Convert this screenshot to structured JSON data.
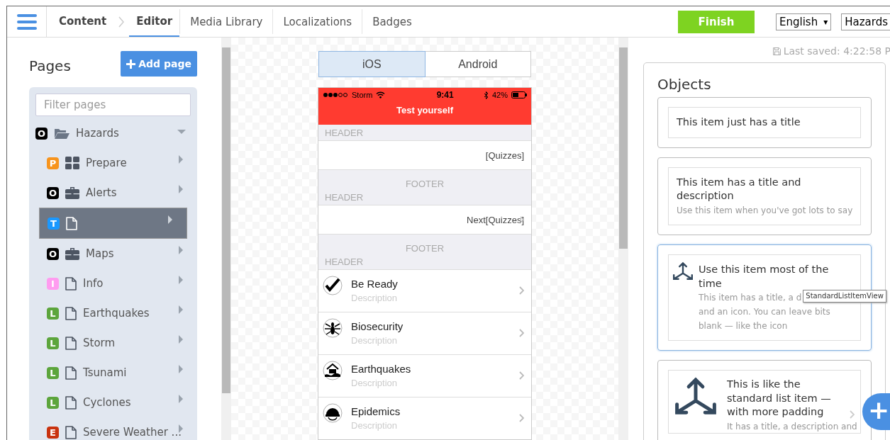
{
  "nav": {
    "breadcrumbs": [
      {
        "label": "Content",
        "selected": false
      },
      {
        "label": "Editor",
        "selected": true
      }
    ],
    "tabs": [
      {
        "label": "Media Library",
        "selected": false
      },
      {
        "label": "Localizations",
        "selected": false
      },
      {
        "label": "Badges",
        "selected": false
      }
    ],
    "finish_button": "Finish",
    "language_select": "English",
    "select_arrow": "▾",
    "app_select": "Hazards"
  },
  "pages": {
    "title": "Pages",
    "add_button": "Add page",
    "filter_placeholder": "Filter pages",
    "tree": [
      {
        "badge": "O",
        "color": "#000000",
        "kind": "folder",
        "label": "Hazards",
        "expanded": true,
        "selected": false,
        "children": [
          {
            "badge": "P",
            "color": "#f7941d",
            "kind": "grid",
            "label": "Prepare",
            "expanded": false,
            "selected": false
          },
          {
            "badge": "O",
            "color": "#000000",
            "kind": "briefcase",
            "label": "Alerts",
            "expanded": false,
            "selected": false
          },
          {
            "badge": "T",
            "color": "#1a98ff",
            "kind": "file",
            "expanded": false,
            "selected": true
          },
          {
            "badge": "O",
            "color": "#000000",
            "kind": "briefcase",
            "label": "Maps",
            "expanded": false,
            "selected": false
          },
          {
            "badge": "I",
            "color": "#ff9cf0",
            "kind": "file",
            "label": "Info",
            "expanded": false,
            "selected": false
          },
          {
            "badge": "L",
            "color": "#5ca53c",
            "kind": "file",
            "label": "Earthquakes",
            "expanded": false,
            "selected": false
          },
          {
            "badge": "L",
            "color": "#5ca53c",
            "kind": "file",
            "label": "Storm",
            "expanded": false,
            "selected": false
          },
          {
            "badge": "L",
            "color": "#5ca53c",
            "kind": "file",
            "label": "Tsunami",
            "expanded": false,
            "selected": false
          },
          {
            "badge": "L",
            "color": "#5ca53c",
            "kind": "file",
            "label": "Cyclones",
            "expanded": false,
            "selected": false
          },
          {
            "badge": "E",
            "color": "#c9330f",
            "kind": "file",
            "label": "Severe Weather ...",
            "expanded": false,
            "selected": false
          }
        ]
      }
    ]
  },
  "preview": {
    "platform_tabs": [
      {
        "label": "iOS",
        "selected": true
      },
      {
        "label": "Android",
        "selected": false
      }
    ],
    "status": {
      "carrier": "Storm",
      "time": "9:41",
      "battery": "42%"
    },
    "title": "Test yourself",
    "rows": [
      {
        "kind": "header",
        "text": "HEADER"
      },
      {
        "kind": "cell",
        "text": "[Quizzes]",
        "chevron": false
      },
      {
        "kind": "footer",
        "text": "FOOTER"
      },
      {
        "kind": "header",
        "text": "HEADER"
      },
      {
        "kind": "cell",
        "text": "Next[Quizzes]",
        "chevron": true
      },
      {
        "kind": "footer",
        "text": "FOOTER"
      },
      {
        "kind": "header",
        "text": "HEADER"
      },
      {
        "kind": "item",
        "title": "Be Ready",
        "description": "Description"
      },
      {
        "kind": "item",
        "title": "Biosecurity",
        "description": "Description"
      },
      {
        "kind": "item",
        "title": "Earthquakes",
        "description": "Description"
      },
      {
        "kind": "item",
        "title": "Epidemics",
        "description": "Description"
      }
    ]
  },
  "objects": {
    "last_saved": "Last saved: 4:22:58 P",
    "title": "Objects",
    "cards": [
      {
        "kind": "plain",
        "selected": false,
        "title": "This item just has a title"
      },
      {
        "kind": "plain",
        "selected": false,
        "title": "This item has a title and description",
        "description": [
          "Use this item when you've got lots to say"
        ]
      },
      {
        "kind": "icon",
        "selected": true,
        "title": "Use this item most of the time",
        "description": [
          "This item has a title, a d",
          "and an icon. You can leave bits",
          "blank — like the icon"
        ],
        "tooltip": "StandardListItemView"
      },
      {
        "kind": "large-icon",
        "selected": false,
        "title": "This is like the standard list item — with more padding",
        "description": [
          "It has a title, a description and"
        ]
      }
    ]
  },
  "fab": "+"
}
